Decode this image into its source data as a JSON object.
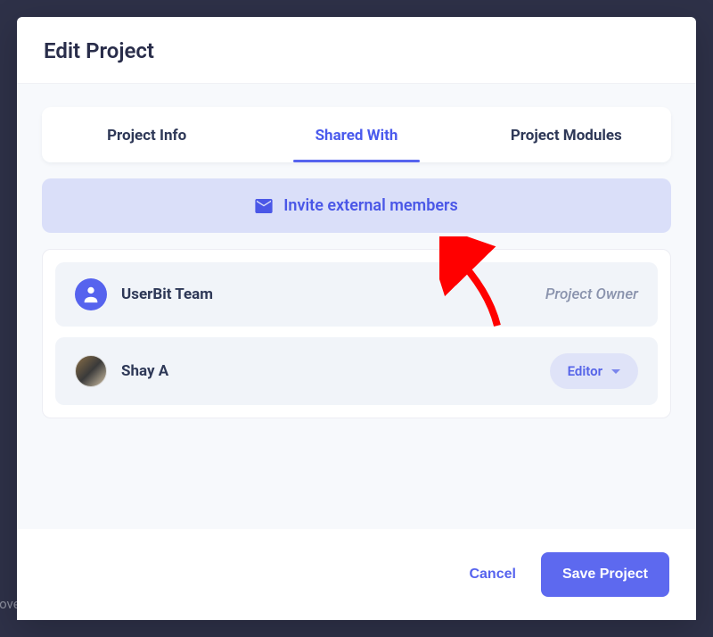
{
  "backdrop_snippet": "Discover Design Opportunities",
  "modal": {
    "title": "Edit Project",
    "tabs": [
      {
        "label": "Project Info",
        "active": false
      },
      {
        "label": "Shared With",
        "active": true
      },
      {
        "label": "Project Modules",
        "active": false
      }
    ],
    "invite": {
      "label": "Invite external members",
      "icon": "mail-icon"
    },
    "members": [
      {
        "name": "UserBit Team",
        "avatar": "team-icon",
        "role_type": "owner",
        "role_label": "Project Owner"
      },
      {
        "name": "Shay A",
        "avatar": "photo",
        "role_type": "editable",
        "role_label": "Editor"
      }
    ],
    "footer": {
      "cancel": "Cancel",
      "save": "Save Project"
    }
  }
}
